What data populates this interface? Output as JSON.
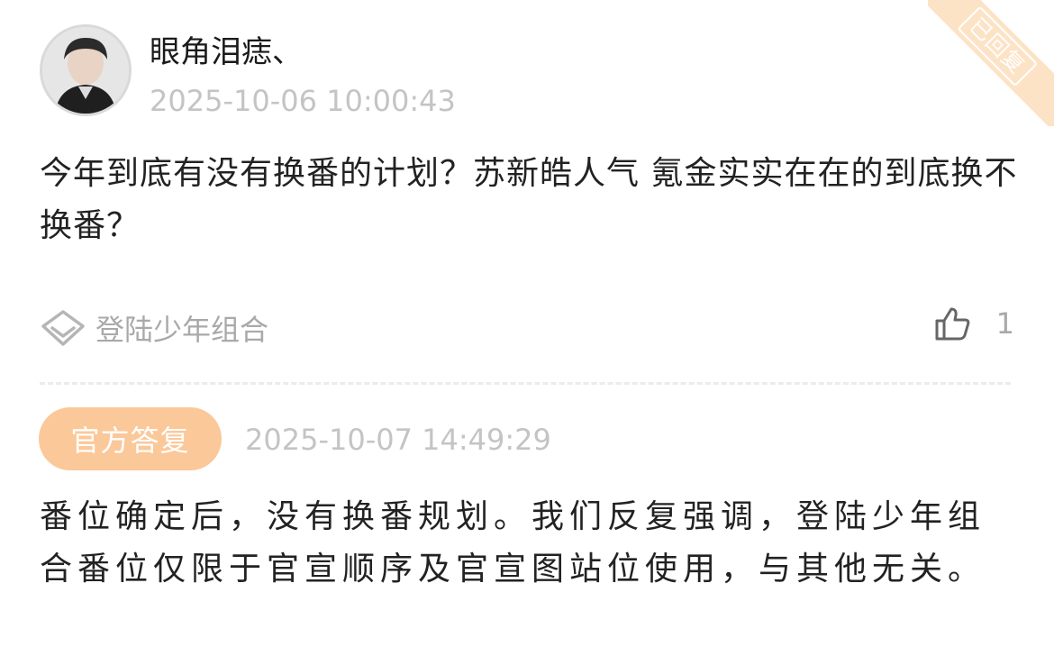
{
  "post": {
    "username": "眼角泪痣、",
    "timestamp": "2025-10-06 10:00:43",
    "question": "今年到底有没有换番的计划？苏新皓人气  氪金实实在在的到底换不换番？",
    "status_stamp": "已回复"
  },
  "tag": {
    "label": "登陆少年组合",
    "icon": "diamond-icon"
  },
  "like": {
    "count": "1",
    "icon": "thumbs-up-icon"
  },
  "reply": {
    "badge_label": "官方答复",
    "timestamp": "2025-10-07 14:49:29",
    "answer": "番位确定后，没有换番规划。我们反复强调，登陆少年组合番位仅限于官宣顺序及官宣图站位使用，与其他无关。"
  },
  "colors": {
    "accent": "#fbc89a",
    "ribbon": "#fde3c6",
    "muted_text": "#a9a9a9"
  }
}
